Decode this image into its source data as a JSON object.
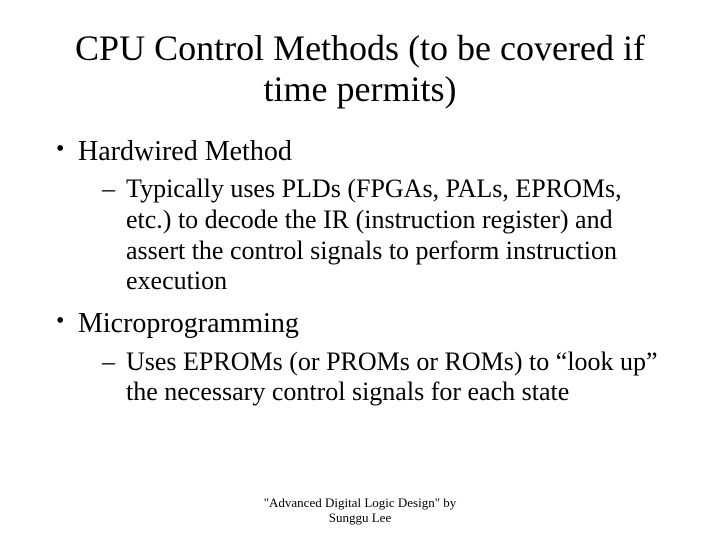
{
  "title": "CPU Control Methods (to be covered if time permits)",
  "bullets": [
    {
      "text": "Hardwired Method",
      "sub": [
        "Typically uses PLDs (FPGAs, PALs, EPROMs, etc.) to decode the IR (instruction register) and assert the control signals to perform instruction execution"
      ]
    },
    {
      "text": "Microprogramming",
      "sub": [
        "Uses EPROMs (or PROMs or ROMs) to “look up” the necessary control signals for each state"
      ]
    }
  ],
  "footer_line1": "\"Advanced Digital Logic Design\" by",
  "footer_line2": "Sunggu Lee"
}
